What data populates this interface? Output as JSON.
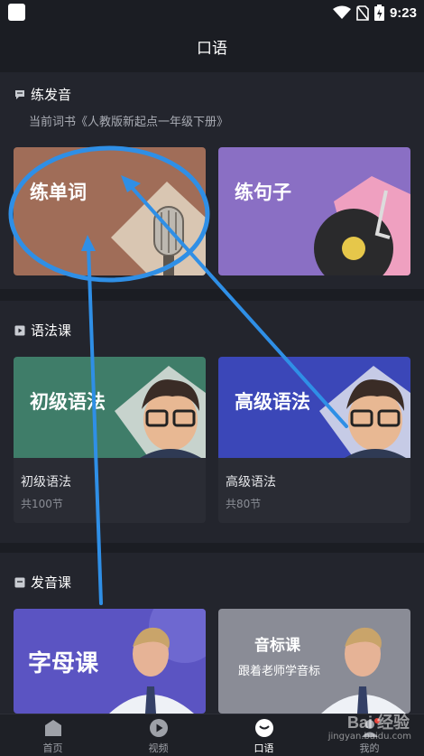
{
  "status_bar": {
    "time": "9:23"
  },
  "header": {
    "title": "口语"
  },
  "practice": {
    "section_title": "练发音",
    "current_book": "当前词书《人教版新起点一年级下册》",
    "cards": [
      {
        "label": "练单词",
        "bg": "#a06d58"
      },
      {
        "label": "练句子",
        "bg": "#8a6fc4"
      }
    ]
  },
  "grammar": {
    "section_title": "语法课",
    "courses": [
      {
        "card_label": "初级语法",
        "title": "初级语法",
        "count": "共100节",
        "bg": "#3f7d69"
      },
      {
        "card_label": "高级语法",
        "title": "高级语法",
        "count": "共80节",
        "bg": "#3b47b8"
      }
    ]
  },
  "phonics": {
    "section_title": "发音课",
    "cards": [
      {
        "label": "字母课"
      },
      {
        "label": "音标课",
        "sublabel": "跟着老师学音标"
      }
    ]
  },
  "tabs": [
    {
      "label": "首页",
      "icon": "home-icon"
    },
    {
      "label": "视频",
      "icon": "play-icon"
    },
    {
      "label": "口语",
      "icon": "chat-icon",
      "active": true
    },
    {
      "label": "我的",
      "icon": "profile-icon"
    }
  ],
  "watermark": {
    "logo": "Bai 经验",
    "url": "jingyan.baidu.com"
  },
  "colors": {
    "background": "#1b1d23",
    "section": "#23252d",
    "annotation": "#2f8fe6"
  }
}
